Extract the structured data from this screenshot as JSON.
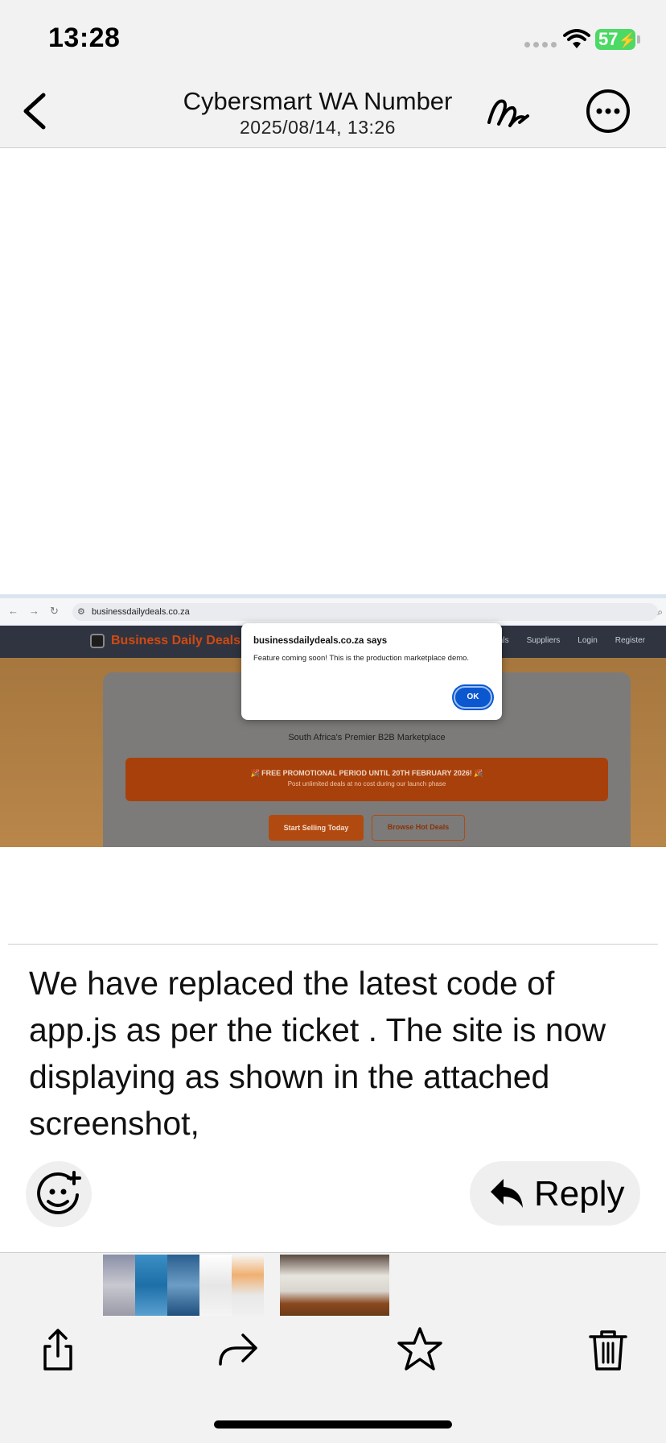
{
  "status_bar": {
    "time": "13:28",
    "battery": "57"
  },
  "header": {
    "title": "Cybersmart WA Number",
    "subtitle": "2025/08/14, 13:26"
  },
  "attachment": {
    "url": "businessdailydeals.co.za",
    "site_brand": "Business Daily Deals",
    "site_nav": [
      "Deals",
      "Suppliers",
      "Login",
      "Register"
    ],
    "tagline": "South Africa's Premier B2B Marketplace",
    "promo_title": "🎉 FREE PROMOTIONAL PERIOD UNTIL 20TH FEBRUARY 2026! 🎉",
    "promo_sub": "Post unlimited deals at no cost during our launch phase",
    "start_selling": "Start Selling Today",
    "browse_deals": "Browse Hot Deals",
    "dialog_title": "businessdailydeals.co.za says",
    "dialog_message": "Feature coming soon! This is the production marketplace demo.",
    "dialog_ok": "OK"
  },
  "message": {
    "body": "We have replaced the latest code of app.js as per the ticket . The site is now displaying as shown in the attached screenshot,"
  },
  "actions": {
    "reply_label": "Reply"
  },
  "icons": {
    "back": "chevron-left-icon",
    "markup": "scribble-icon",
    "more": "ellipsis-circle-icon",
    "emoji": "emoji-add-icon",
    "reply": "reply-arrow-icon",
    "share": "share-icon",
    "forward": "forward-arrow-icon",
    "favorite": "star-icon",
    "delete": "trash-icon"
  }
}
